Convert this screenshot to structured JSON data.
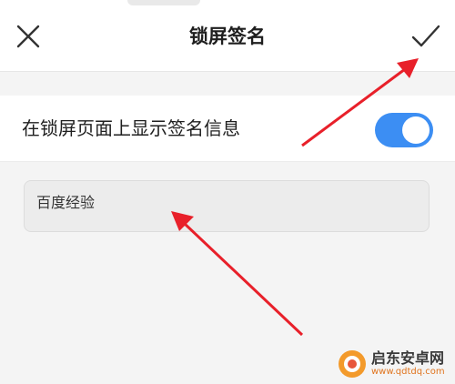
{
  "header": {
    "title": "锁屏签名",
    "close_icon": "close-icon",
    "confirm_icon": "checkmark-icon"
  },
  "settings": {
    "show_signature_label": "在锁屏页面上显示签名信息",
    "show_signature_enabled": true
  },
  "signature": {
    "value": "百度经验"
  },
  "watermark": {
    "name": "启东安卓网",
    "url": "www.qdtdq.com"
  },
  "colors": {
    "toggle_on": "#3c8ef3",
    "arrow": "#e8202a",
    "background": "#f4f4f4"
  }
}
